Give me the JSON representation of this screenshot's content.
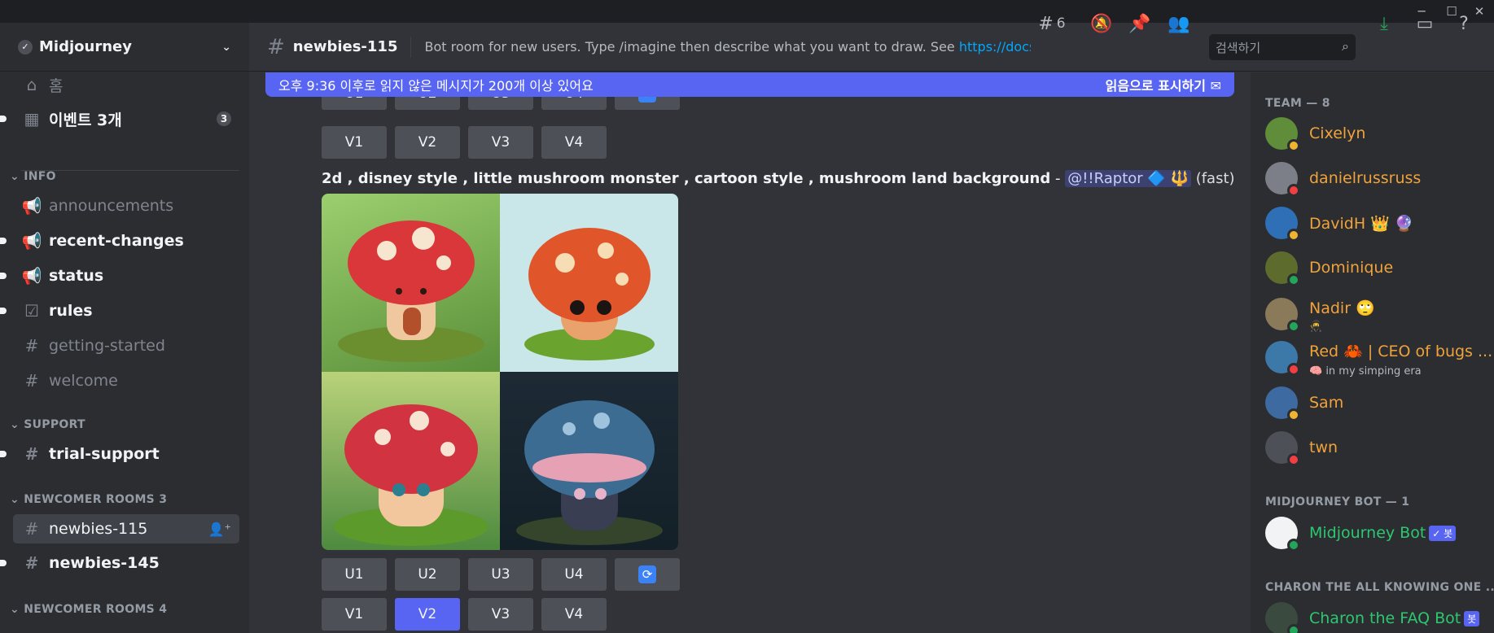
{
  "window": {
    "minimize": "─",
    "maximize": "☐",
    "close": "✕"
  },
  "server": {
    "name": "Midjourney",
    "verified": "✓",
    "chevron": "⌄"
  },
  "sidebar": {
    "home": "홈",
    "events": "이벤트 3개",
    "events_count": "3",
    "categories": {
      "info": "INFO",
      "support": "SUPPORT",
      "newcomer3": "NEWCOMER ROOMS 3",
      "newcomer4": "NEWCOMER ROOMS 4"
    },
    "channels": {
      "announcements": "announcements",
      "recent_changes": "recent-changes",
      "status": "status",
      "rules": "rules",
      "getting_started": "getting-started",
      "welcome": "welcome",
      "trial_support": "trial-support",
      "newbies_115": "newbies-115",
      "newbies_145": "newbies-145"
    }
  },
  "header": {
    "channel": "newbies-115",
    "topic": "Bot room for new users. Type /imagine then describe what you want to draw. See ",
    "topic_link": "https://docs.mid...",
    "threads_count": "6",
    "search_placeholder": "검색하기"
  },
  "banner": {
    "text": "오후 9:36 이후로 읽지 않은 메시지가 200개 이상 있어요",
    "action": "읽음으로 표시하기"
  },
  "message": {
    "prompt": "2d , disney style , little mushroom monster , cartoon style , mushroom land background",
    "dash": " - ",
    "mention": "@!!Raptor 🔷 🔱",
    "speed": "(fast)"
  },
  "buttons": {
    "u1": "U1",
    "u2": "U2",
    "u3": "U3",
    "u4": "U4",
    "v1": "V1",
    "v2": "V2",
    "v3": "V3",
    "v4": "V4",
    "reroll": "⟳"
  },
  "members": {
    "team_header": "TEAM — 8",
    "team": [
      {
        "name": "Cixelyn",
        "status_color": "#f0b232",
        "avatar_color": "#5f8d3a"
      },
      {
        "name": "danielrussruss",
        "status_color": "#f23f43",
        "avatar_color": "#7c7f88"
      },
      {
        "name": "DavidH 👑 🔮",
        "status_color": "#f0b232",
        "avatar_color": "#2f6fb5"
      },
      {
        "name": "Dominique",
        "status_color": "#23a55a",
        "avatar_color": "#5d6b2c"
      },
      {
        "name": "Nadir 🙄",
        "status_color": "#23a55a",
        "avatar_color": "#8a7a5a"
      },
      {
        "name": "Red 🦀 | CEO of bugs ...",
        "status_color": "#f23f43",
        "avatar_color": "#3c78a8"
      },
      {
        "name": "Sam",
        "status_color": "#f0b232",
        "avatar_color": "#3d6aa0"
      },
      {
        "name": "twn",
        "status_color": "#f23f43",
        "avatar_color": "#4e5058"
      }
    ],
    "nadir_sub": "🥷",
    "red_sub": "🧠 in my simping era",
    "bot_header": "MIDJOURNEY BOT — 1",
    "bot_name": "Midjourney Bot",
    "bot_tag": "✓ 봇",
    "charon_header": "CHARON THE ALL KNOWING ONE ...",
    "charon_name": "Charon the FAQ Bot",
    "charon_tag": "봇"
  }
}
